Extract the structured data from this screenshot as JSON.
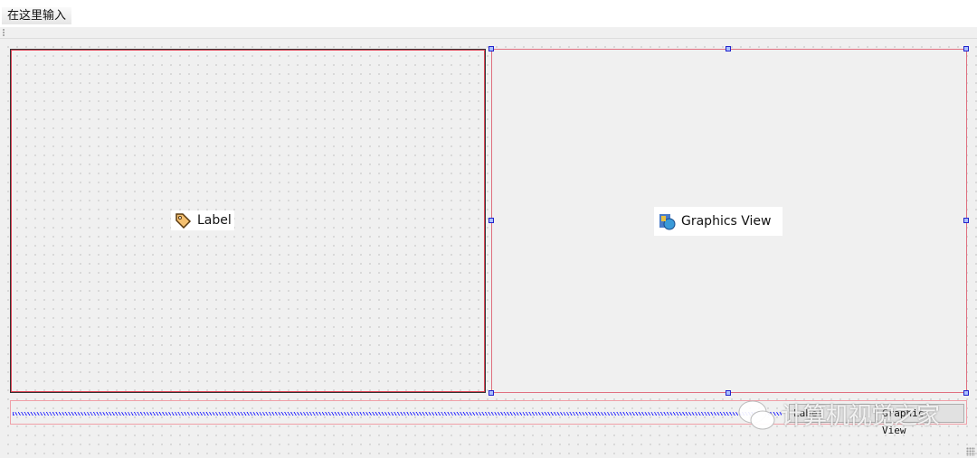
{
  "menubar": {
    "placeholder_item": "在这里输入"
  },
  "widgets": {
    "label": {
      "text": "Label",
      "icon": "tag-icon"
    },
    "graphics_view": {
      "text": "Graphics View",
      "icon": "graphics-view-icon",
      "selected": true
    }
  },
  "bottom_bar": {
    "buttons": [
      "Label",
      "Graphics View"
    ]
  },
  "watermark": {
    "text": "计算机视觉之家"
  },
  "colors": {
    "selection_handle": "#2222cc",
    "layout_border": "#e07080",
    "spacer": "#3333ff"
  }
}
